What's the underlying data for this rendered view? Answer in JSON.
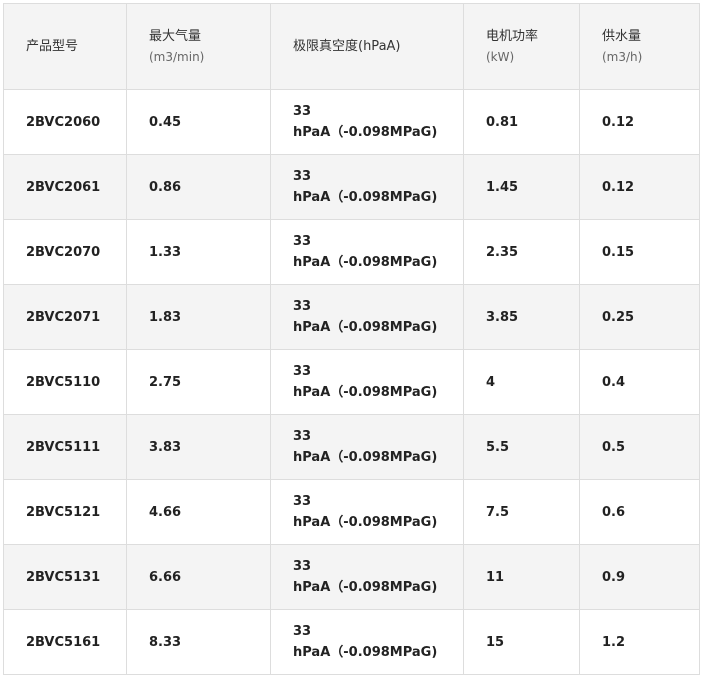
{
  "table": {
    "headers": [
      {
        "label": "产品型号",
        "unit": ""
      },
      {
        "label": "最大气量",
        "unit": "(m3/min)"
      },
      {
        "label": "极限真空度(hPaA)",
        "unit": ""
      },
      {
        "label": "电机功率",
        "unit": "(kW)"
      },
      {
        "label": "供水量",
        "unit": "(m3/h)"
      }
    ],
    "rows": [
      {
        "model": "2BVC2060",
        "flow": "0.45",
        "vac1": "33",
        "vac2": "hPaA（-0.098MPaG)",
        "power": "0.81",
        "water": "0.12"
      },
      {
        "model": "2BVC2061",
        "flow": "0.86",
        "vac1": "33",
        "vac2": "hPaA（-0.098MPaG)",
        "power": "1.45",
        "water": "0.12"
      },
      {
        "model": "2BVC2070",
        "flow": "1.33",
        "vac1": "33",
        "vac2": "hPaA（-0.098MPaG)",
        "power": "2.35",
        "water": "0.15"
      },
      {
        "model": "2BVC2071",
        "flow": "1.83",
        "vac1": "33",
        "vac2": "hPaA（-0.098MPaG)",
        "power": "3.85",
        "water": "0.25"
      },
      {
        "model": "2BVC5110",
        "flow": "2.75",
        "vac1": "33",
        "vac2": "hPaA（-0.098MPaG)",
        "power": "4",
        "water": "0.4"
      },
      {
        "model": "2BVC5111",
        "flow": "3.83",
        "vac1": "33",
        "vac2": "hPaA（-0.098MPaG)",
        "power": "5.5",
        "water": "0.5"
      },
      {
        "model": "2BVC5121",
        "flow": "4.66",
        "vac1": "33",
        "vac2": "hPaA（-0.098MPaG)",
        "power": "7.5",
        "water": "0.6"
      },
      {
        "model": "2BVC5131",
        "flow": "6.66",
        "vac1": "33",
        "vac2": "hPaA（-0.098MPaG)",
        "power": "11",
        "water": "0.9"
      },
      {
        "model": "2BVC5161",
        "flow": "8.33",
        "vac1": "33",
        "vac2": "hPaA（-0.098MPaG)",
        "power": "15",
        "water": "1.2"
      }
    ]
  }
}
